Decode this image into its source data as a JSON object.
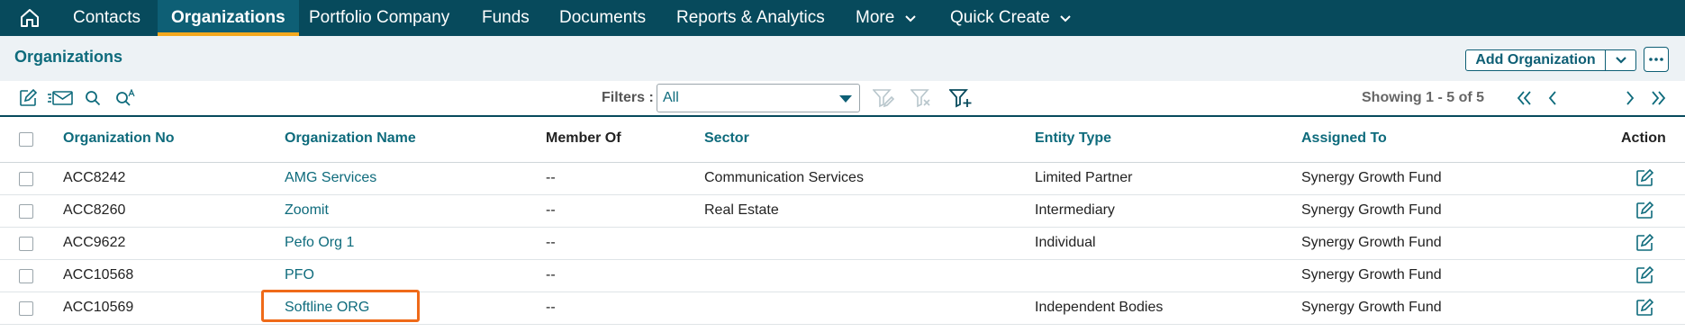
{
  "nav": {
    "items": [
      {
        "label": "Contacts"
      },
      {
        "label": "Organizations"
      },
      {
        "label": "Portfolio Company"
      },
      {
        "label": "Funds"
      },
      {
        "label": "Documents"
      },
      {
        "label": "Reports & Analytics"
      },
      {
        "label": "More"
      },
      {
        "label": "Quick Create"
      }
    ],
    "active": "Organizations"
  },
  "page": {
    "title": "Organizations",
    "add_button_label": "Add Organization"
  },
  "toolbar": {
    "filters_label": "Filters :",
    "filter_value": "All",
    "showing_text": "Showing 1 - 5 of 5"
  },
  "table": {
    "columns": [
      "Organization No",
      "Organization Name",
      "Member Of",
      "Sector",
      "Entity Type",
      "Assigned To",
      "Action"
    ],
    "rows": [
      {
        "org_no": "ACC8242",
        "name": "AMG Services",
        "member_of": "--",
        "sector": "Communication Services",
        "entity_type": "Limited Partner",
        "assigned_to": "Synergy Growth Fund"
      },
      {
        "org_no": "ACC8260",
        "name": "Zoomit",
        "member_of": "--",
        "sector": "Real Estate",
        "entity_type": "Intermediary",
        "assigned_to": "Synergy Growth Fund"
      },
      {
        "org_no": "ACC9622",
        "name": "Pefo Org 1",
        "member_of": "--",
        "sector": "",
        "entity_type": "Individual",
        "assigned_to": "Synergy Growth Fund"
      },
      {
        "org_no": "ACC10568",
        "name": "PFO",
        "member_of": "--",
        "sector": "",
        "entity_type": "",
        "assigned_to": "Synergy Growth Fund"
      },
      {
        "org_no": "ACC10569",
        "name": "Softline ORG",
        "member_of": "--",
        "sector": "",
        "entity_type": "Independent Bodies",
        "assigned_to": "Synergy Growth Fund"
      }
    ]
  },
  "colors": {
    "nav_bg": "#074a5c",
    "accent": "#0e6b7c",
    "active_underline": "#f4a81d",
    "highlight": "#ef6a19"
  }
}
